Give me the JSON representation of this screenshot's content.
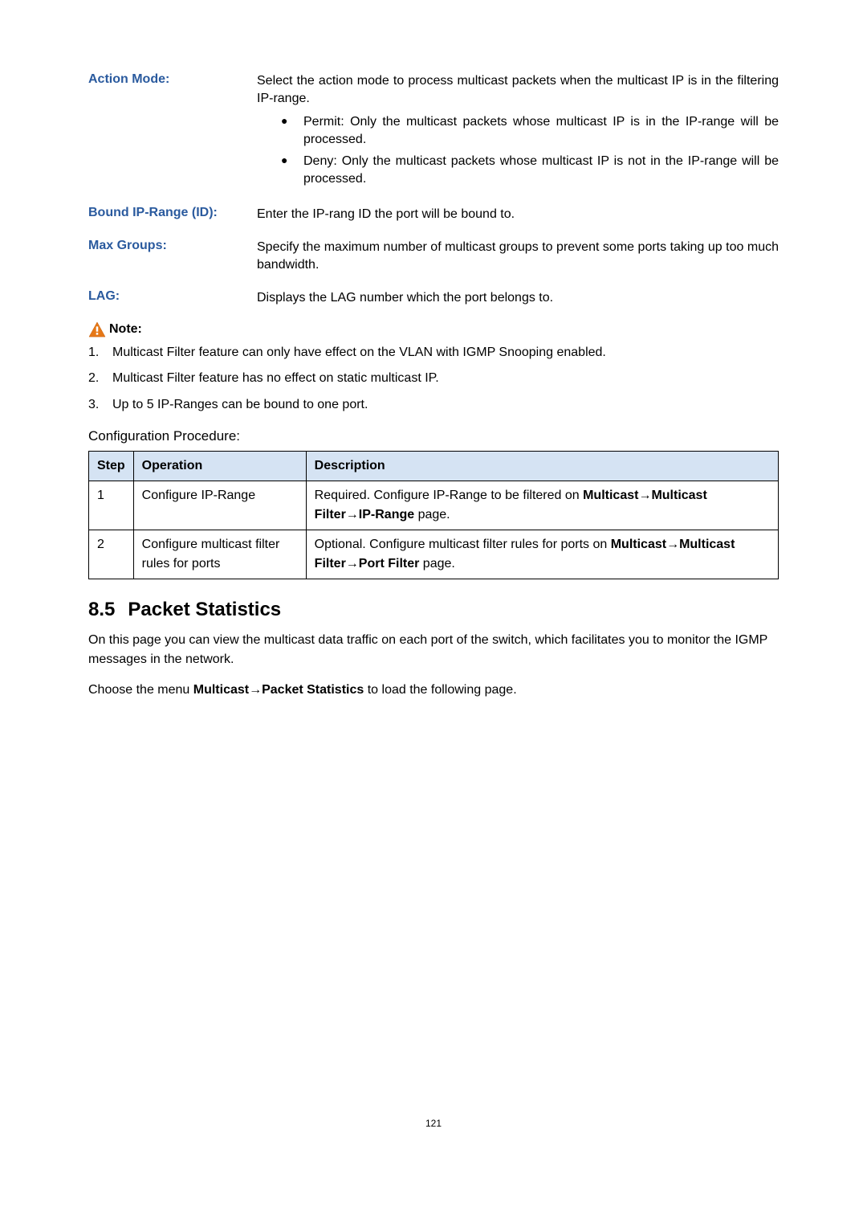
{
  "definitions": [
    {
      "term": "Action Mode:",
      "desc": "Select the action mode to process multicast packets when the multicast IP is in the filtering IP-range.",
      "bullets": [
        "Permit: Only the multicast packets whose multicast IP is in the IP-range will be processed.",
        "Deny: Only the multicast packets whose multicast IP is not in the IP-range will be processed."
      ]
    },
    {
      "term": "Bound IP-Range (ID):",
      "desc": "Enter the IP-rang ID the port will be bound to."
    },
    {
      "term": "Max Groups:",
      "desc": "Specify the maximum number of multicast groups to prevent some ports taking up too much bandwidth."
    },
    {
      "term": "LAG:",
      "desc": "Displays the LAG number which the port belongs to."
    }
  ],
  "note": {
    "label": "Note:",
    "items": [
      "Multicast Filter feature can only have effect on the VLAN with IGMP Snooping enabled.",
      "Multicast Filter feature has no effect on static multicast IP.",
      "Up to 5 IP-Ranges can be bound to one port."
    ]
  },
  "config_procedure_title": "Configuration Procedure:",
  "table": {
    "headers": {
      "step": "Step",
      "operation": "Operation",
      "description": "Description"
    },
    "rows": [
      {
        "step": "1",
        "operation": "Configure IP-Range",
        "desc_prefix": "Required. Configure IP-Range to be filtered on ",
        "desc_bold": "Multicast→Multicast Filter→IP-Range",
        "desc_suffix": " page."
      },
      {
        "step": "2",
        "operation": "Configure multicast filter rules for ports",
        "desc_prefix": "Optional. Configure multicast filter rules for ports on ",
        "desc_bold": "Multicast→Multicast Filter→Port Filter",
        "desc_suffix": " page."
      }
    ]
  },
  "section": {
    "number": "8.5",
    "title": "Packet Statistics"
  },
  "paragraphs": {
    "p1": "On this page you can view the multicast data traffic on each port of the switch, which facilitates you to monitor the IGMP messages in the network.",
    "p2_prefix": "Choose the menu ",
    "p2_bold": "Multicast→Packet Statistics",
    "p2_suffix": " to load the following page."
  },
  "page_number": "121"
}
